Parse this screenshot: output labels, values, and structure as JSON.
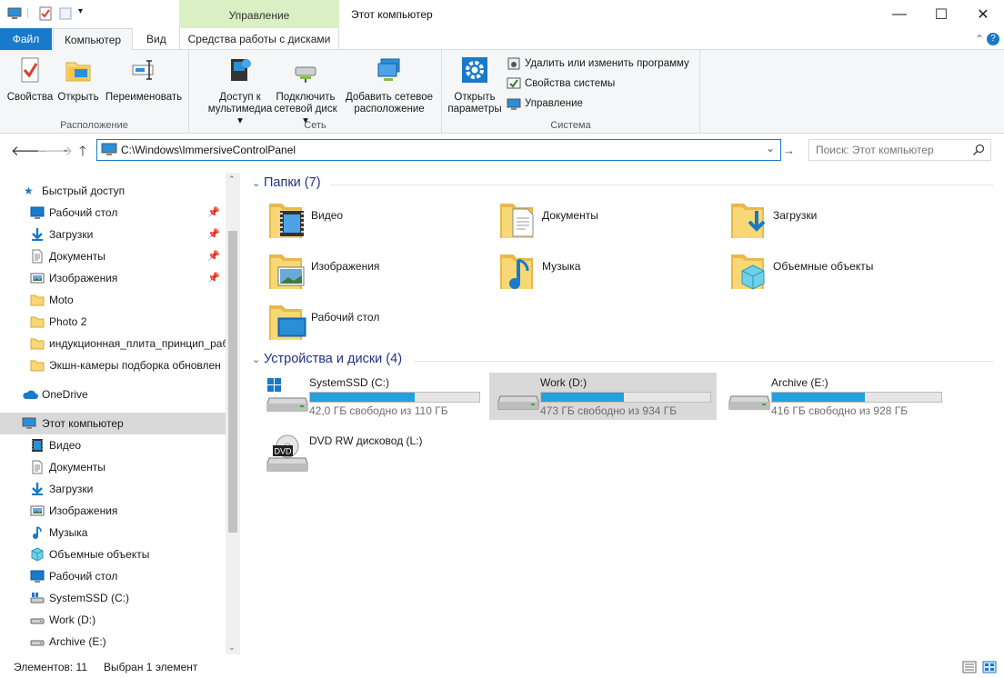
{
  "window": {
    "title": "Этот компьютер",
    "context_group": "Управление",
    "minimize": "—",
    "maximize": "☐",
    "close": "✕"
  },
  "tabs": {
    "file": "Файл",
    "computer": "Компьютер",
    "view": "Вид",
    "drive_tools": "Средства работы с дисками",
    "collapse": "⌃",
    "help": "?"
  },
  "ribbon": {
    "location": {
      "label": "Расположение",
      "properties": "Свойства",
      "open": "Открыть",
      "rename": "Переименовать"
    },
    "network": {
      "label": "Сеть",
      "media_line1": "Доступ к",
      "media_line2": "мультимедиа",
      "map_line1": "Подключить",
      "map_line2": "сетевой диск",
      "addnet_line1": "Добавить сетевое",
      "addnet_line2": "расположение"
    },
    "system": {
      "label": "Система",
      "settings_line1": "Открыть",
      "settings_line2": "параметры",
      "uninstall": "Удалить или изменить программу",
      "sysprops": "Свойства системы",
      "manage": "Управление"
    }
  },
  "nav": {
    "address": "C:\\Windows\\ImmersiveControlPanel",
    "search_placeholder": "Поиск: Этот компьютер"
  },
  "sidebar": {
    "quick_access": "Быстрый доступ",
    "items": [
      {
        "label": "Рабочий стол",
        "icon": "desktop-icon",
        "pinned": true
      },
      {
        "label": "Загрузки",
        "icon": "downloads-icon",
        "pinned": true
      },
      {
        "label": "Документы",
        "icon": "documents-icon",
        "pinned": true
      },
      {
        "label": "Изображения",
        "icon": "pictures-icon",
        "pinned": true
      },
      {
        "label": "Moto",
        "icon": "folder-icon",
        "pinned": false
      },
      {
        "label": "Photo 2",
        "icon": "folder-icon",
        "pinned": false
      },
      {
        "label": "индукционная_плита_принцип_раб",
        "icon": "folder-icon",
        "pinned": false
      },
      {
        "label": "Экшн-камеры подборка обновлен",
        "icon": "folder-icon",
        "pinned": false
      }
    ],
    "onedrive": "OneDrive",
    "this_pc": "Этот компьютер",
    "pc_items": [
      {
        "label": "Видео",
        "icon": "videos-icon"
      },
      {
        "label": "Документы",
        "icon": "documents-icon"
      },
      {
        "label": "Загрузки",
        "icon": "downloads-icon"
      },
      {
        "label": "Изображения",
        "icon": "pictures-icon"
      },
      {
        "label": "Музыка",
        "icon": "music-icon"
      },
      {
        "label": "Объемные объекты",
        "icon": "3d-objects-icon"
      },
      {
        "label": "Рабочий стол",
        "icon": "desktop-icon"
      },
      {
        "label": "SystemSSD (C:)",
        "icon": "system-drive-icon"
      },
      {
        "label": "Work (D:)",
        "icon": "drive-icon"
      },
      {
        "label": "Archive (E:)",
        "icon": "drive-icon"
      }
    ]
  },
  "main": {
    "folders_header": "Папки (7)",
    "folders": [
      {
        "label": "Видео",
        "icon": "videos-folder-icon"
      },
      {
        "label": "Документы",
        "icon": "documents-folder-icon"
      },
      {
        "label": "Загрузки",
        "icon": "downloads-folder-icon"
      },
      {
        "label": "Изображения",
        "icon": "pictures-folder-icon"
      },
      {
        "label": "Музыка",
        "icon": "music-folder-icon"
      },
      {
        "label": "Объемные объекты",
        "icon": "3d-objects-folder-icon"
      },
      {
        "label": "Рабочий стол",
        "icon": "desktop-folder-icon"
      }
    ],
    "drives_header": "Устройства и диски (4)",
    "drives": [
      {
        "name": "SystemSSD (C:)",
        "free": "42,0 ГБ свободно из 110 ГБ",
        "used_fraction": 0.62,
        "selected": false
      },
      {
        "name": "Work (D:)",
        "free": "473 ГБ свободно из 934 ГБ",
        "used_fraction": 0.49,
        "selected": true
      },
      {
        "name": "Archive (E:)",
        "free": "416 ГБ свободно из 928 ГБ",
        "used_fraction": 0.55,
        "selected": false
      },
      {
        "name": "DVD RW дисковод (L:)",
        "dvd_label": "DVD"
      }
    ]
  },
  "status": {
    "count": "Элементов: 11",
    "selected": "Выбран 1 элемент"
  },
  "colors": {
    "accent": "#1979ca",
    "bar_fill": "#26a0da",
    "context_tab": "#dbefc4",
    "folder_yellow": "#f8d775"
  }
}
